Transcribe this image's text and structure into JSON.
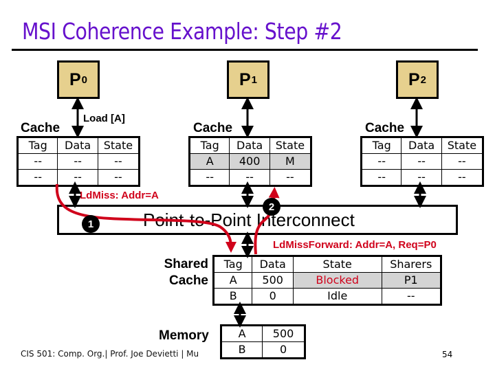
{
  "slide": {
    "title": "MSI Coherence Example: Step #2",
    "page_number": "54",
    "footer": "CIS 501: Comp. Org.| Prof. Joe Devietti | Mu"
  },
  "colors": {
    "title": "#6611cc",
    "processor_fill": "#e6d08e",
    "message_red": "#d0021b",
    "highlight_row": "#d4d4d4"
  },
  "processors": [
    {
      "name": "P",
      "sub": "0",
      "action_label": "Load [A]",
      "cache_label": "Cache",
      "cache": {
        "headers": [
          "Tag",
          "Data",
          "State"
        ],
        "rows": [
          [
            "--",
            "--",
            "--"
          ],
          [
            "--",
            "--",
            "--"
          ]
        ],
        "highlight_row": null
      }
    },
    {
      "name": "P",
      "sub": "1",
      "action_label": "",
      "cache_label": "Cache",
      "cache": {
        "headers": [
          "Tag",
          "Data",
          "State"
        ],
        "rows": [
          [
            "A",
            "400",
            "M"
          ],
          [
            "--",
            "--",
            "--"
          ]
        ],
        "highlight_row": 0
      }
    },
    {
      "name": "P",
      "sub": "2",
      "action_label": "",
      "cache_label": "Cache",
      "cache": {
        "headers": [
          "Tag",
          "Data",
          "State"
        ],
        "rows": [
          [
            "--",
            "--",
            "--"
          ],
          [
            "--",
            "--",
            "--"
          ]
        ],
        "highlight_row": null
      }
    }
  ],
  "interconnect": {
    "label": "Point-to-Point Interconnect"
  },
  "messages": [
    {
      "step": "1",
      "label": "LdMiss: Addr=A"
    },
    {
      "step": "2",
      "label": "LdMissForward: Addr=A, Req=P0"
    }
  ],
  "shared_cache": {
    "label_line1": "Shared",
    "label_line2": "Cache",
    "headers": [
      "Tag",
      "Data",
      "State",
      "Sharers"
    ],
    "rows": [
      [
        "A",
        "500",
        "Blocked",
        "P1"
      ],
      [
        "B",
        "0",
        "Idle",
        "--"
      ]
    ],
    "highlight_row": 0,
    "red_cell": "Blocked"
  },
  "memory": {
    "label": "Memory",
    "rows": [
      [
        "A",
        "500"
      ],
      [
        "B",
        "0"
      ]
    ]
  }
}
